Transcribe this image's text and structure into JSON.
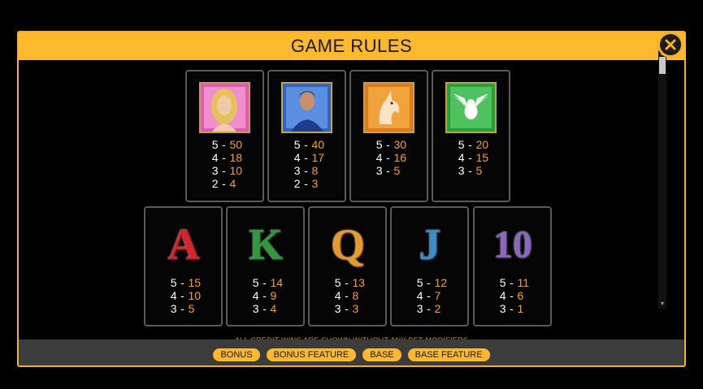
{
  "header": {
    "title": "GAME RULES"
  },
  "footer_note": "ALL CREDIT WINS ARE SHOWN WITHOUT ANY BET MODIFIERS",
  "picture_symbols": [
    {
      "name": "woman",
      "pays": [
        {
          "count": "5",
          "value": "50"
        },
        {
          "count": "4",
          "value": "18"
        },
        {
          "count": "3",
          "value": "10"
        },
        {
          "count": "2",
          "value": "4"
        }
      ]
    },
    {
      "name": "man",
      "pays": [
        {
          "count": "5",
          "value": "40"
        },
        {
          "count": "4",
          "value": "17"
        },
        {
          "count": "3",
          "value": "8"
        },
        {
          "count": "2",
          "value": "3"
        }
      ]
    },
    {
      "name": "unicorn",
      "pays": [
        {
          "count": "5",
          "value": "30"
        },
        {
          "count": "4",
          "value": "16"
        },
        {
          "count": "3",
          "value": "5"
        }
      ]
    },
    {
      "name": "dove",
      "pays": [
        {
          "count": "5",
          "value": "20"
        },
        {
          "count": "4",
          "value": "15"
        },
        {
          "count": "3",
          "value": "5"
        }
      ]
    }
  ],
  "letter_symbols": [
    {
      "glyph": "A",
      "color": "#d9232a",
      "pays": [
        {
          "count": "5",
          "value": "15"
        },
        {
          "count": "4",
          "value": "10"
        },
        {
          "count": "3",
          "value": "5"
        }
      ]
    },
    {
      "glyph": "K",
      "color": "#2f9a3d",
      "pays": [
        {
          "count": "5",
          "value": "14"
        },
        {
          "count": "4",
          "value": "9"
        },
        {
          "count": "3",
          "value": "4"
        }
      ]
    },
    {
      "glyph": "Q",
      "color": "#e89a2a",
      "pays": [
        {
          "count": "5",
          "value": "13"
        },
        {
          "count": "4",
          "value": "8"
        },
        {
          "count": "3",
          "value": "3"
        }
      ]
    },
    {
      "glyph": "J",
      "color": "#3a8ec4",
      "pays": [
        {
          "count": "5",
          "value": "12"
        },
        {
          "count": "4",
          "value": "7"
        },
        {
          "count": "3",
          "value": "2"
        }
      ]
    },
    {
      "glyph": "10",
      "color": "#8a68b8",
      "pays": [
        {
          "count": "5",
          "value": "11"
        },
        {
          "count": "4",
          "value": "6"
        },
        {
          "count": "3",
          "value": "1"
        }
      ]
    }
  ],
  "tabs": [
    "BONUS",
    "BONUS FEATURE",
    "BASE",
    "BASE FEATURE"
  ],
  "colors": {
    "accent": "#fbb92b",
    "pay_value": "#f7a01f",
    "panel_border": "#5a5a5a"
  },
  "icons": {
    "close": "close-icon"
  }
}
